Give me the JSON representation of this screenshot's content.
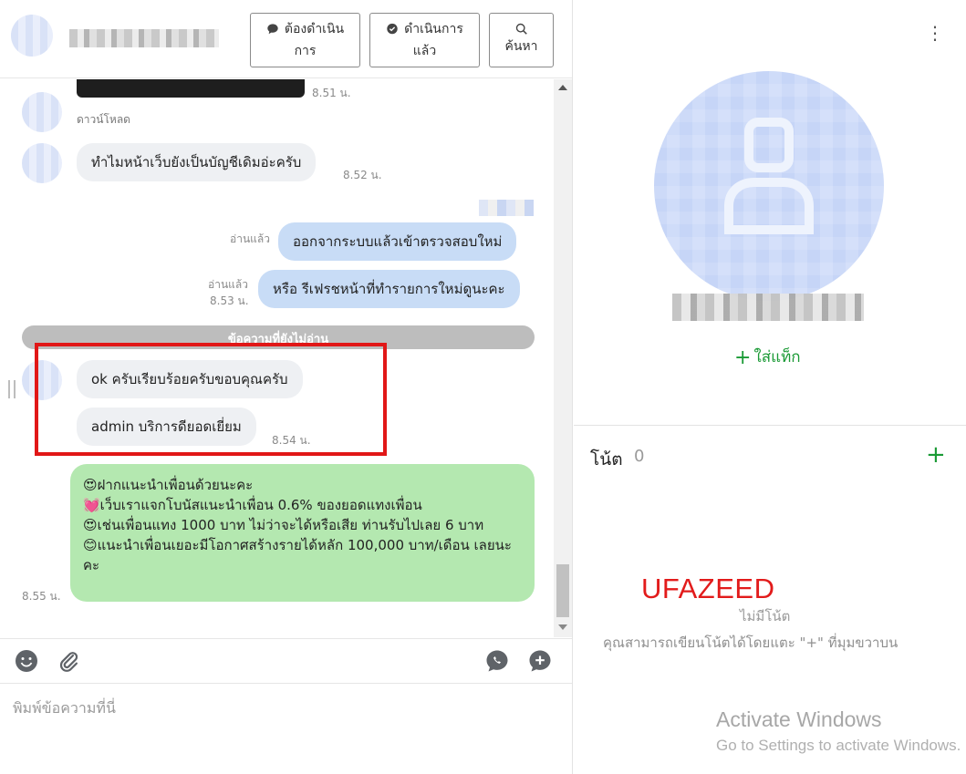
{
  "header": {
    "buttons": {
      "pending": {
        "line1": "ต้องดำเนิน",
        "line2": "การ",
        "icon": "chat-bubble-icon"
      },
      "done": {
        "line1": "ดำเนินการ",
        "line2": "แล้ว",
        "icon": "check-bubble-icon"
      },
      "search": {
        "line1": "",
        "line2": "ค้นหา",
        "icon": "search-icon"
      }
    }
  },
  "messages": {
    "top_attachment_time": "8.51 น.",
    "download_label": "ดาวน์โหลด",
    "msg1": {
      "text": "ทำไมหน้าเว็บยังเป็นบัญชีเดิมอ่ะครับ",
      "time": "8.52 น."
    },
    "msg2": {
      "text": "ออกจากระบบแล้วเข้าตรวจสอบใหม่",
      "read": "อ่านแล้ว"
    },
    "msg3": {
      "text": "หรือ รีเฟรชหน้าที่ทำรายการใหม่ดูนะคะ",
      "read": "อ่านแล้ว",
      "time": "8.53 น."
    },
    "unread_divider": "ข้อความที่ยังไม่อ่าน",
    "msg4": {
      "text": "ok ครับเรียบร้อยครับขอบคุณครับ"
    },
    "msg5": {
      "text": "admin บริการดียอดเยี่ยม",
      "time": "8.54 น."
    },
    "msg6": {
      "lines": [
        "😍ฝากแนะนำเพื่อนด้วยนะคะ",
        "💓เว็บเราแจกโบนัสแนะนำเพื่อน 0.6% ของยอดแทงเพื่อน",
        "😍เช่นเพื่อนแทง 1000 บาท ไม่ว่าจะได้หรือเสีย ท่านรับไปเลย 6 บาท",
        "😊แนะนำเพื่อนเยอะมีโอกาศสร้างรายได้หลัก 100,000 บาท/เดือน เลยนะคะ"
      ],
      "time": "8.55 น."
    }
  },
  "composer": {
    "placeholder": "พิมพ์ข้อความที่นี่",
    "icons": [
      "emoji-icon",
      "attachment-icon",
      "quick-reply-icon",
      "add-action-icon"
    ]
  },
  "profile": {
    "add_tag": "ใส่แท็ก",
    "notes_title": "โน้ต",
    "notes_count": "0",
    "no_notes": "ไม่มีโน้ต",
    "notes_hint": "คุณสามารถเขียนโน้ตได้โดยแตะ \"+\" ที่มุมขวาบน",
    "watermark": "UFAZEED"
  },
  "os_overlay": {
    "title": "Activate Windows",
    "subtitle": "Go to Settings to activate Windows."
  },
  "colors": {
    "accent_green": "#1a9a35",
    "outgoing_bubble": "#c8dcf6",
    "incoming_bubble": "#eef0f3",
    "promo_bubble": "#b4e8b0",
    "highlight_red": "#e11717"
  }
}
